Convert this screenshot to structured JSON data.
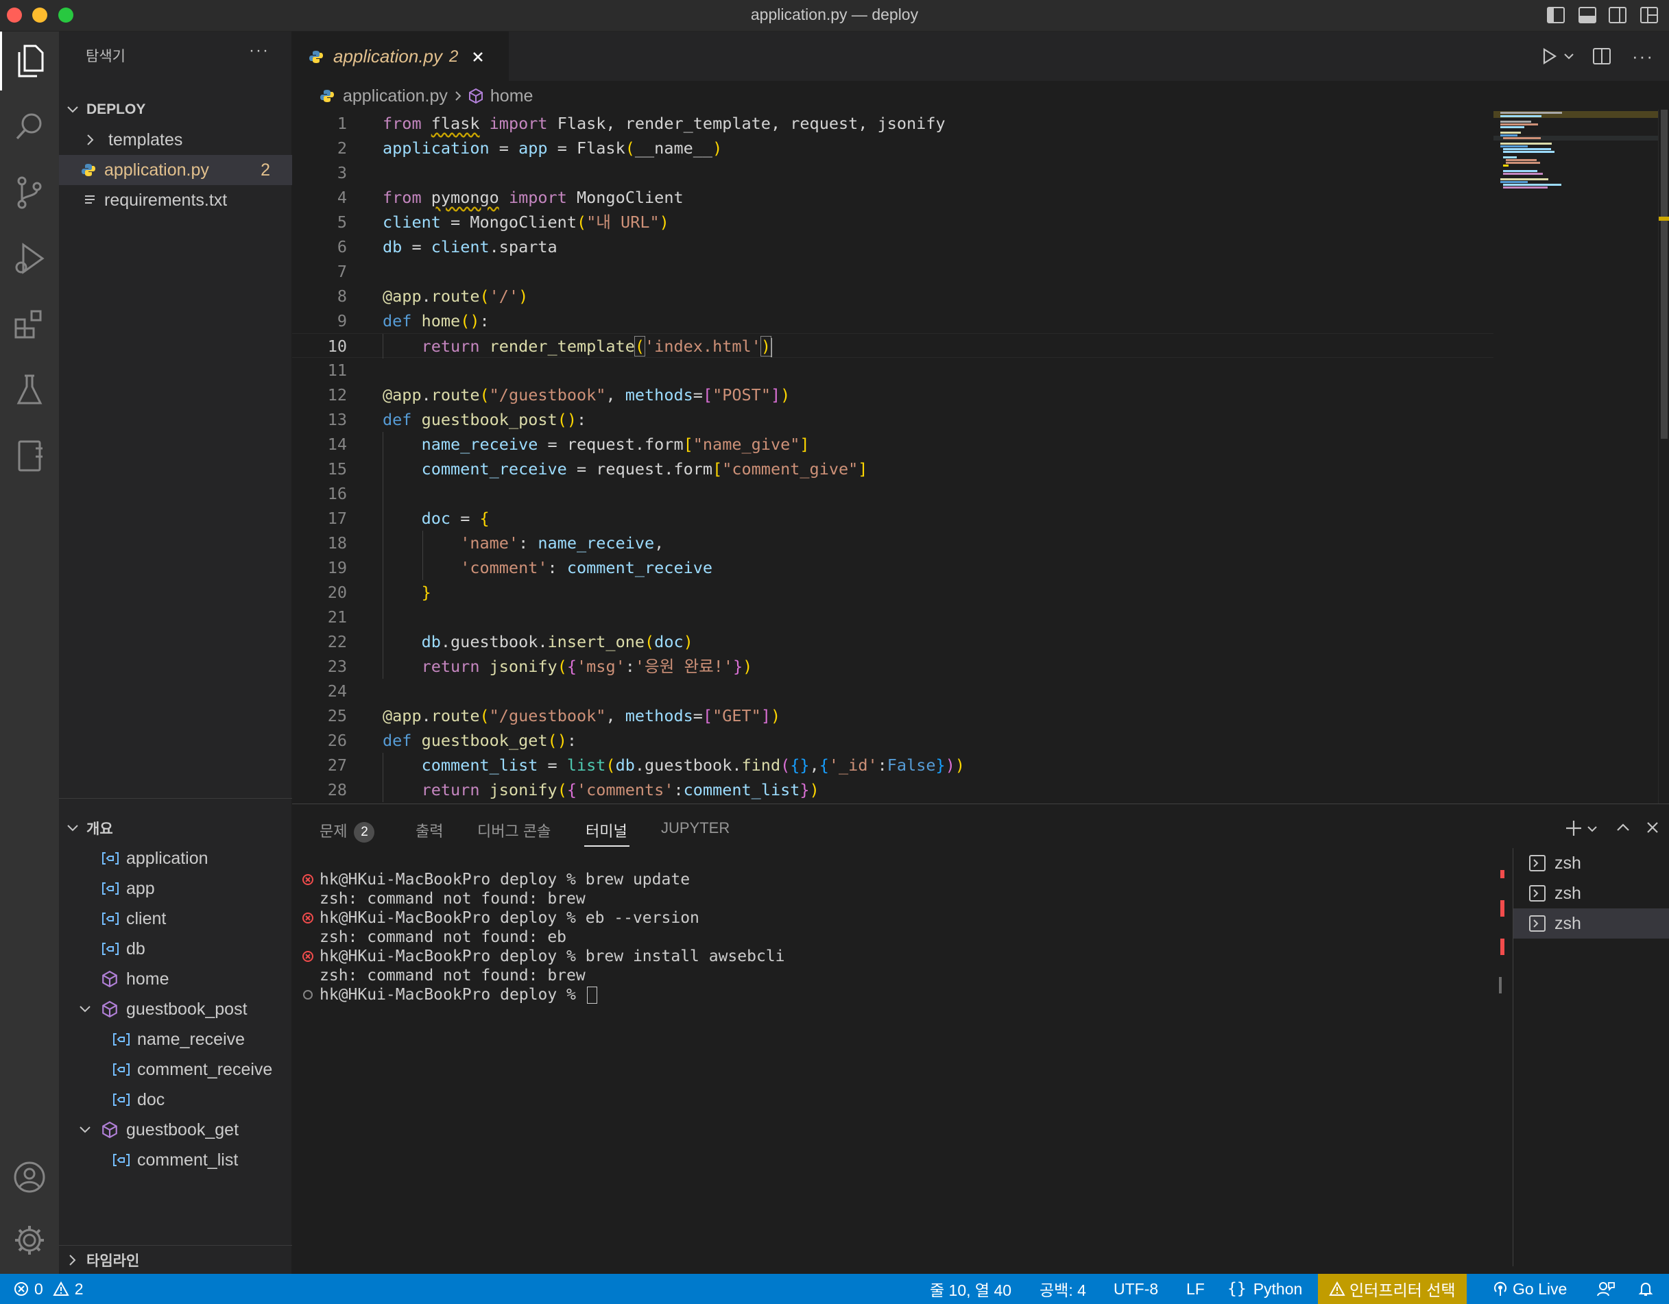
{
  "window": {
    "title": "application.py — deploy"
  },
  "sidebar": {
    "title": "탐색기",
    "folder": "DEPLOY",
    "files": [
      {
        "label": "templates",
        "type": "folder"
      },
      {
        "label": "application.py",
        "badge": "2",
        "type": "python"
      },
      {
        "label": "requirements.txt",
        "type": "text"
      }
    ],
    "outline": {
      "title": "개요",
      "items": [
        {
          "label": "application",
          "kind": "variable"
        },
        {
          "label": "app",
          "kind": "variable"
        },
        {
          "label": "client",
          "kind": "variable"
        },
        {
          "label": "db",
          "kind": "variable"
        },
        {
          "label": "home",
          "kind": "function"
        },
        {
          "label": "guestbook_post",
          "kind": "function"
        },
        {
          "label": "name_receive",
          "kind": "variable"
        },
        {
          "label": "comment_receive",
          "kind": "variable"
        },
        {
          "label": "doc",
          "kind": "variable"
        },
        {
          "label": "guestbook_get",
          "kind": "function"
        },
        {
          "label": "comment_list",
          "kind": "variable"
        }
      ]
    },
    "timeline": "타임라인"
  },
  "editor": {
    "tab": {
      "label": "application.py",
      "badge": "2"
    },
    "breadcrumb": {
      "file": "application.py",
      "symbol": "home"
    },
    "current_line": 10,
    "lines": [
      "1",
      "2",
      "3",
      "4",
      "5",
      "6",
      "7",
      "8",
      "9",
      "10",
      "11",
      "12",
      "13",
      "14",
      "15",
      "16",
      "17",
      "18",
      "19",
      "20",
      "21",
      "22",
      "23",
      "24",
      "25",
      "26",
      "27",
      "28"
    ]
  },
  "panel": {
    "tabs": {
      "problems": "문제",
      "problems_count": "2",
      "output": "출력",
      "debug": "디버그 콘솔",
      "terminal": "터미널",
      "jupyter": "JUPYTER"
    },
    "terminal_lines": [
      {
        "text": "hk@HKui-MacBookPro deploy % brew update",
        "mark": "error"
      },
      {
        "text": "zsh: command not found: brew",
        "mark": "none"
      },
      {
        "text": "hk@HKui-MacBookPro deploy % eb --version",
        "mark": "error"
      },
      {
        "text": "zsh: command not found: eb",
        "mark": "none"
      },
      {
        "text": "hk@HKui-MacBookPro deploy % brew install awsebcli",
        "mark": "error"
      },
      {
        "text": "zsh: command not found: brew",
        "mark": "none"
      },
      {
        "text": "hk@HKui-MacBookPro deploy % ",
        "mark": "prompt"
      }
    ],
    "terminals": [
      "zsh",
      "zsh",
      "zsh"
    ]
  },
  "statusbar": {
    "errors": "0",
    "warnings": "2",
    "position": "줄 10, 열 40",
    "spaces": "공백: 4",
    "encoding": "UTF-8",
    "eol": "LF",
    "language": "Python",
    "interpreter": "인터프리터 선택",
    "golive": "Go Live"
  },
  "colors": {
    "accent": "#007acc",
    "warning": "#c19c00",
    "modified": "#e2c08d",
    "error": "#f14c4c"
  }
}
